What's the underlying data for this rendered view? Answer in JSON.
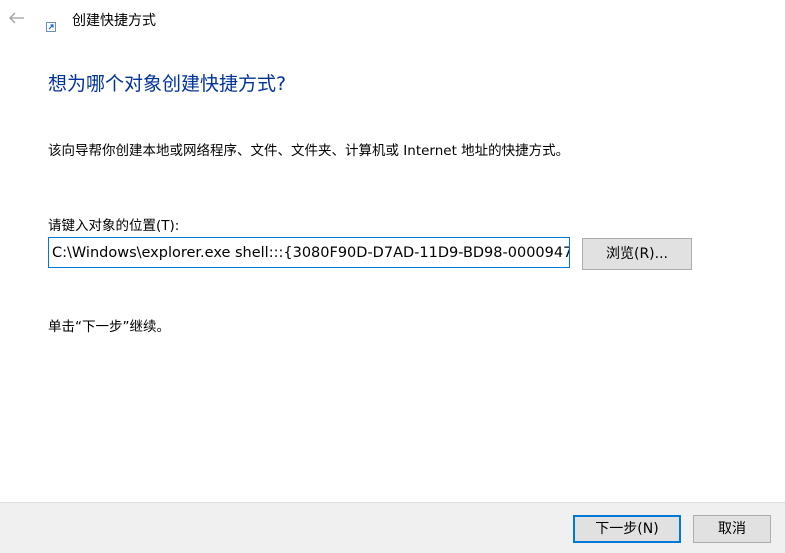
{
  "window": {
    "title": "创建快捷方式",
    "back_icon": "back-arrow-icon",
    "app_icon": "shortcut-icon"
  },
  "main": {
    "heading": "想为哪个对象创建快捷方式?",
    "description": "该向导帮你创建本地或网络程序、文件、文件夹、计算机或 Internet 地址的快捷方式。",
    "location_label": "请键入对象的位置(T):",
    "location_value": "C:\\Windows\\explorer.exe shell:::{3080F90D-D7AD-11D9-BD98-0000947",
    "browse_label": "浏览(R)...",
    "hint": "单击“下一步”继续。"
  },
  "footer": {
    "next_label": "下一步(N)",
    "cancel_label": "取消"
  },
  "colors": {
    "heading": "#003399",
    "focus_border": "#0078d7",
    "button_face": "#e1e1e1",
    "footer_bg": "#f0f0f0"
  }
}
